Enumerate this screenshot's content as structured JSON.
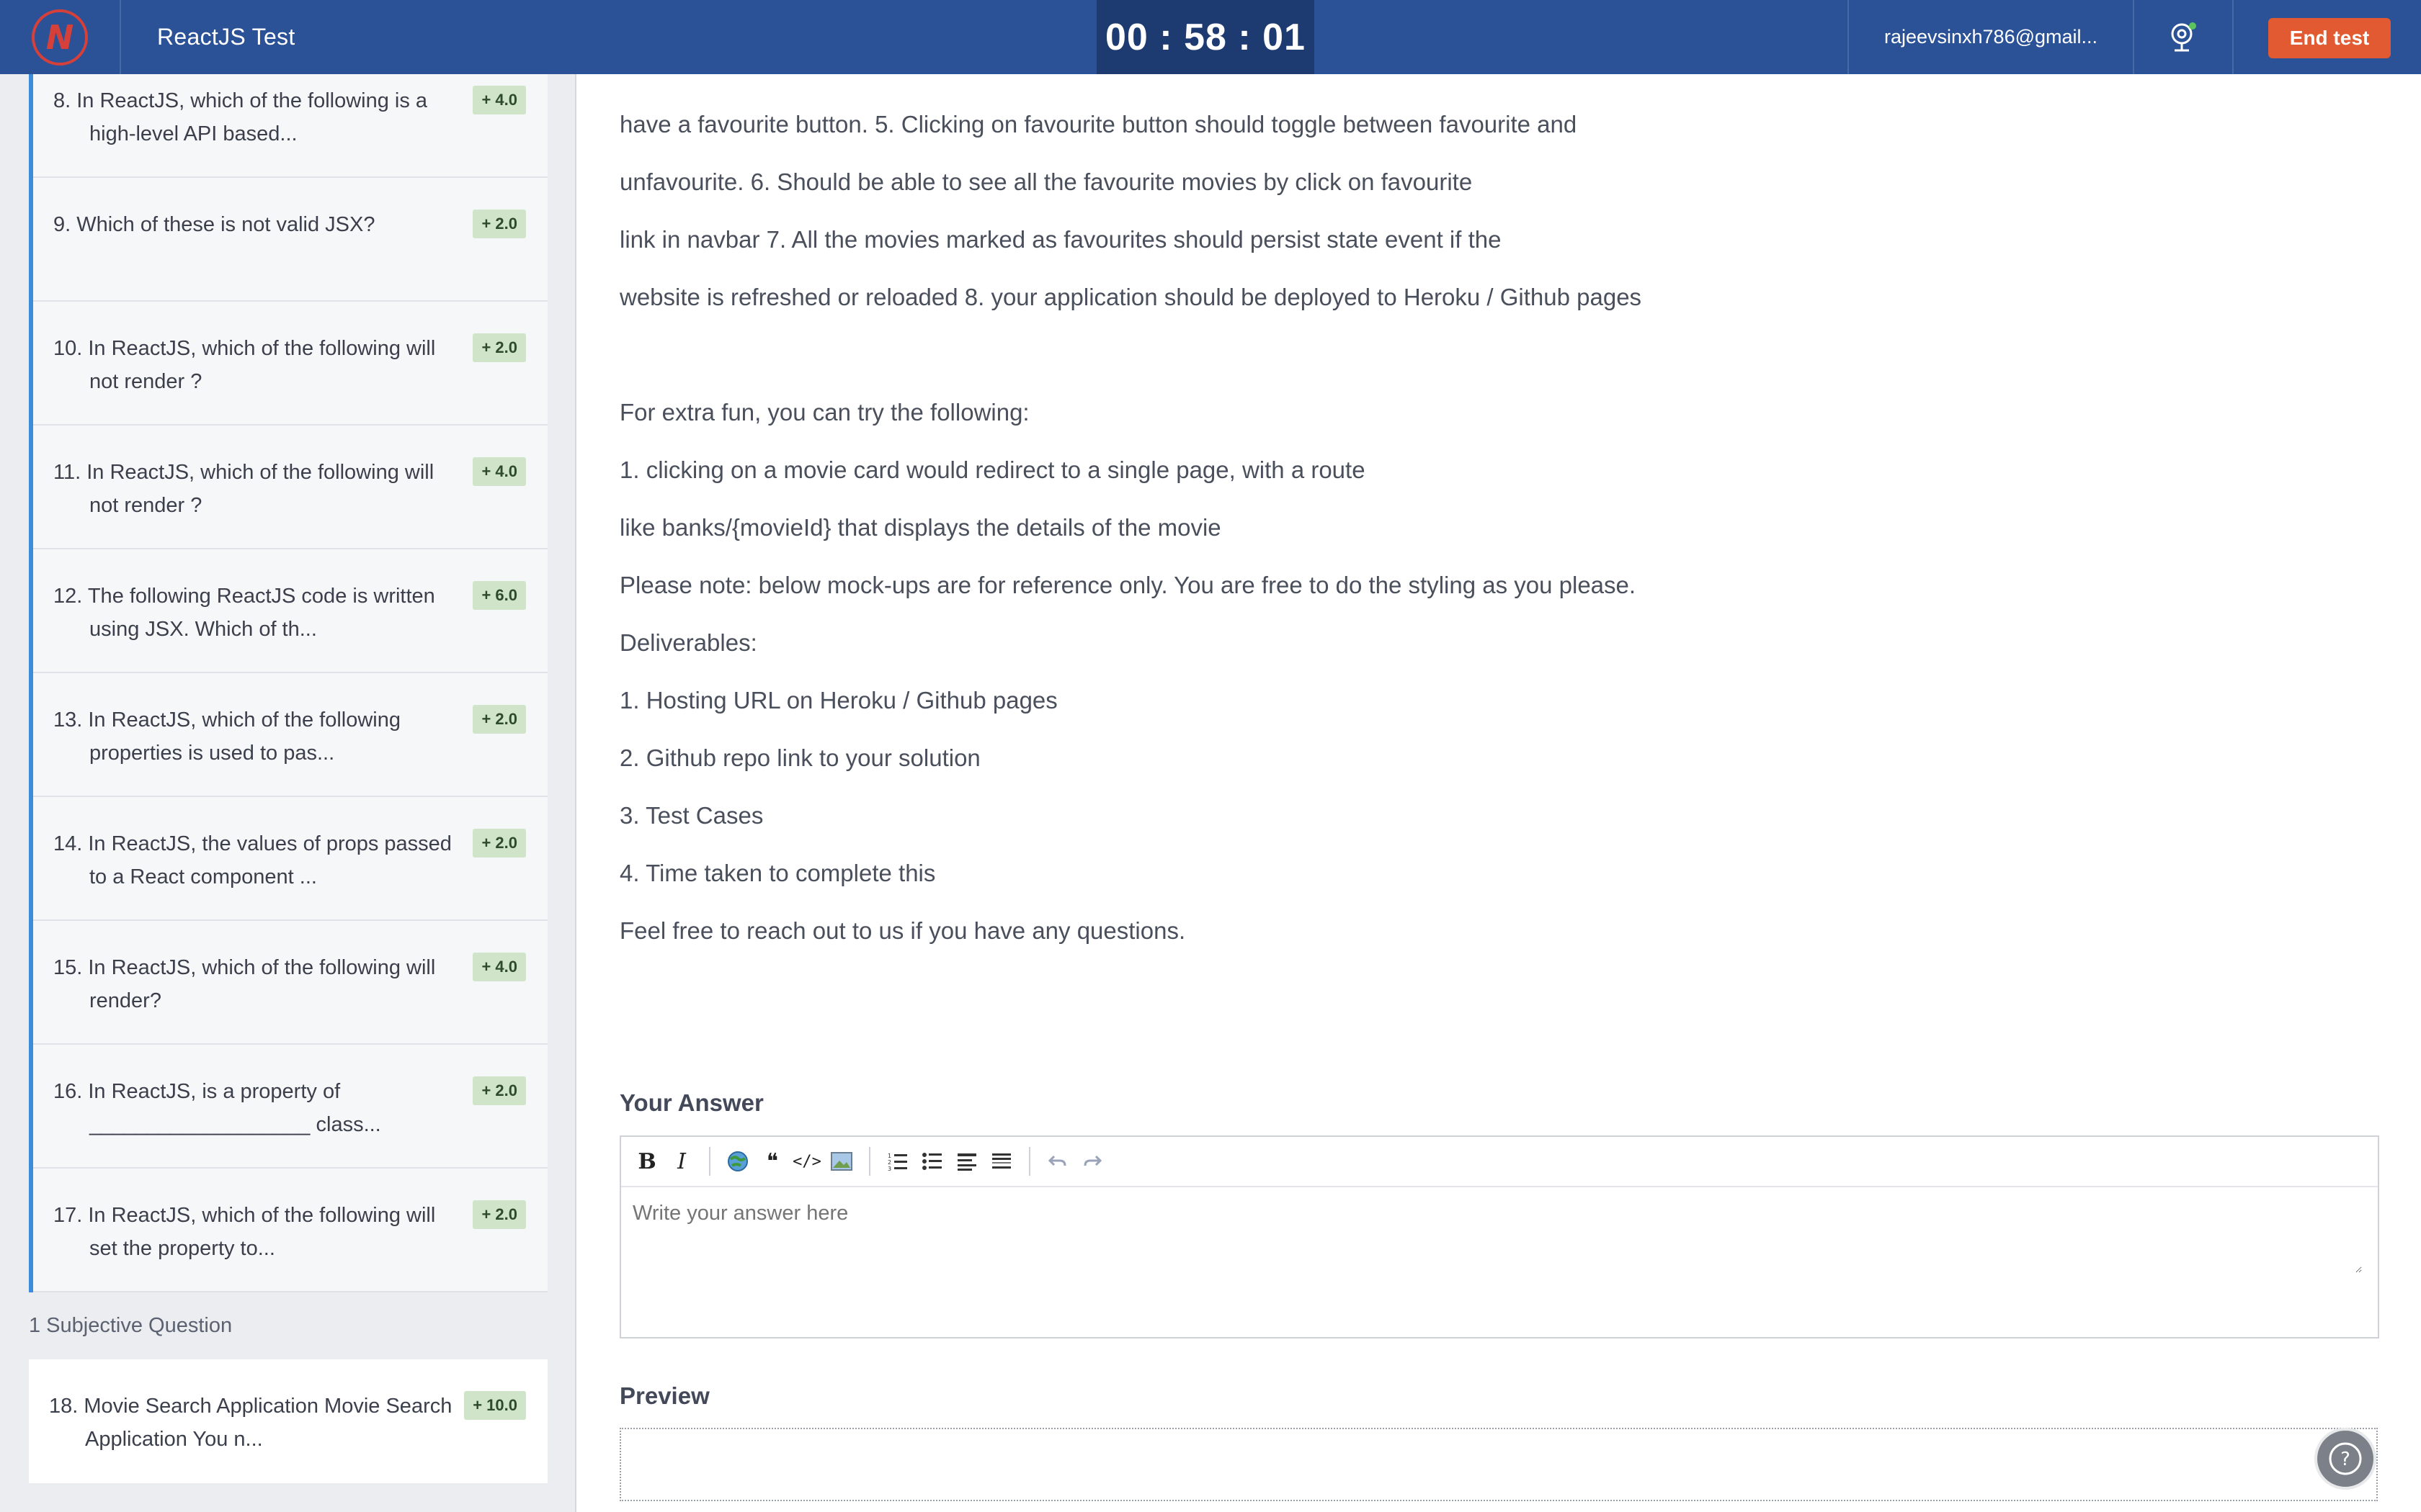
{
  "header": {
    "logo_letter": "N",
    "title": "ReactJS Test",
    "timer": "00 : 58 : 01",
    "user_email": "rajeevsinxh786@gmail...",
    "end_test_label": "End test"
  },
  "sidebar": {
    "questions": [
      {
        "text": "8. In ReactJS, which of the following is a high-level API based...",
        "points": "+ 4.0"
      },
      {
        "text": "9. Which of these is not valid JSX?",
        "points": "+ 2.0"
      },
      {
        "text": "10. In ReactJS, which of the following will not render ?",
        "points": "+ 2.0"
      },
      {
        "text": "11. In ReactJS, which of the following will not render ?",
        "points": "+ 4.0"
      },
      {
        "text": "12. The following ReactJS code is written using JSX. Which of th...",
        "points": "+ 6.0"
      },
      {
        "text": "13. In ReactJS, which of the following properties is used to pas...",
        "points": "+ 2.0"
      },
      {
        "text": "14. In ReactJS, the values of props passed to a React component ...",
        "points": "+ 2.0"
      },
      {
        "text": "15. In ReactJS, which of the following will render?",
        "points": "+ 4.0"
      },
      {
        "text": "16. In ReactJS, is a property of ___________________ class...",
        "points": "+ 2.0"
      },
      {
        "text": "17. In ReactJS, which of the following will set the property to...",
        "points": "+ 2.0"
      }
    ],
    "subjective_label": "1 Subjective Question",
    "subjective_item": {
      "text": "18. Movie Search Application  Movie Search Application  You n...",
      "points": "+ 10.0"
    }
  },
  "main": {
    "lines": [
      "have a favourite button. 5. Clicking on favourite button should toggle between favourite and",
      "unfavourite. 6. Should be able to see all the favourite movies by click on favourite",
      "link in navbar 7. All the movies marked as favourites should persist state event if the",
      "website is refreshed or reloaded 8. your application should be deployed to Heroku / Github pages",
      "",
      "For extra fun, you can try the following:",
      "1. clicking on a movie card would redirect to a single page, with a route",
      "like banks/{movieId} that displays the details of the movie",
      "Please note: below mock-ups are for reference only. You are free to do the styling as you please.",
      "Deliverables:",
      "1. Hosting URL on Heroku / Github pages",
      "2. Github repo link to your solution",
      "3. Test Cases",
      "4. Time taken to complete this",
      "Feel free to reach out to us if you have any questions."
    ],
    "answer_label": "Your Answer",
    "answer_placeholder": "Write your answer here",
    "preview_label": "Preview",
    "toolbar": {
      "bold": "B",
      "italic": "I",
      "quote": "❝",
      "code": "</>"
    },
    "help_icon": "?"
  },
  "colors": {
    "header_bg": "#2b5296",
    "timer_bg": "#1d3b70",
    "end_button": "#e15a31",
    "badge_bg": "#cfe4c9",
    "accent_border": "#3b8ddb"
  }
}
